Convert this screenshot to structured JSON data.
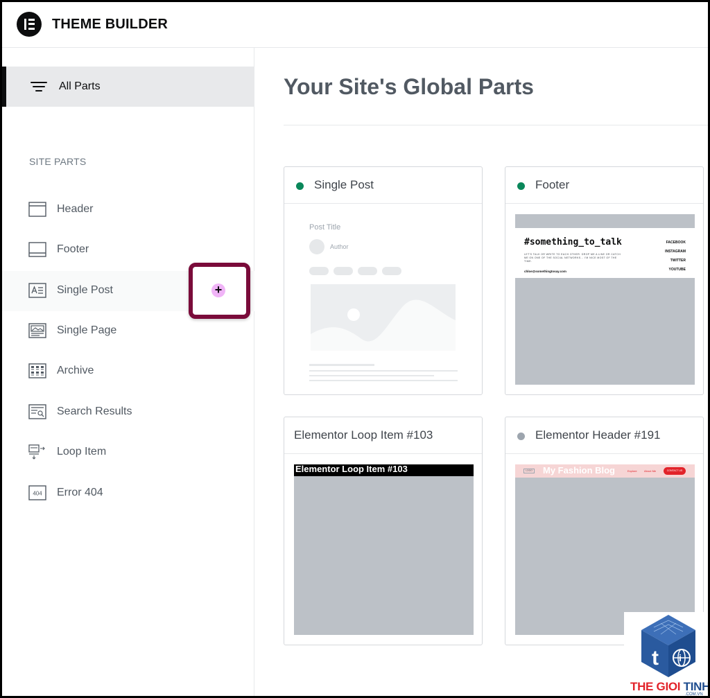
{
  "app": {
    "title": "THEME BUILDER"
  },
  "sidebar": {
    "all_parts_label": "All Parts",
    "section_label": "SITE PARTS",
    "items": [
      {
        "label": "Header",
        "icon": "header-icon"
      },
      {
        "label": "Footer",
        "icon": "footer-icon"
      },
      {
        "label": "Single Post",
        "icon": "single-post-icon"
      },
      {
        "label": "Single Page",
        "icon": "single-page-icon"
      },
      {
        "label": "Archive",
        "icon": "archive-icon"
      },
      {
        "label": "Search Results",
        "icon": "search-results-icon"
      },
      {
        "label": "Loop Item",
        "icon": "loop-item-icon"
      },
      {
        "label": "Error 404",
        "icon": "error-404-icon"
      }
    ],
    "add_button_label": "+"
  },
  "main": {
    "title": "Your Site's Global Parts",
    "cards": [
      {
        "title": "Single Post",
        "status_color": "#0a875a",
        "preview": {
          "post_title": "Post Title",
          "author": "Author"
        }
      },
      {
        "title": "Footer",
        "status_color": "#0a875a",
        "preview": {
          "heading": "#something_to_talk",
          "body": "LET'S TALK OR WRITE TO EACH OTHER. DROP ME A LINE OR CATCH ME ON ONE OF THE SOCIAL NETWORKS... I'M NICE MOST OF THE TIME.",
          "email": "chloe@somethingtosay.com",
          "links": [
            "FACEBOOK",
            "INSTAGRAM",
            "TWITTER",
            "YOUTUBE"
          ]
        }
      },
      {
        "title": "Elementor Loop Item #103",
        "status_color": "",
        "preview": {
          "banner": "Elementor Loop Item #103"
        }
      },
      {
        "title": "Elementor Header #191",
        "status_color": "#9da5ae",
        "preview": {
          "logo_text": "My Fashion Blog",
          "nav": [
            "Explore",
            "About Me"
          ],
          "cta": "CONTACT US",
          "badge": "LOGO"
        }
      }
    ]
  },
  "watermark": {
    "line1": "THE GIOI",
    "line2": "TINHOC",
    "sub": ".COM.VN"
  },
  "colors": {
    "accent": "#7a0b3a",
    "add_button": "#f0b4f7",
    "published": "#0a875a",
    "draft": "#9da5ae"
  }
}
